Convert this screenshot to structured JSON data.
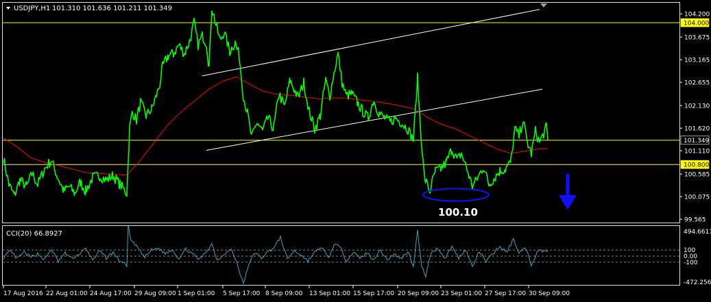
{
  "header": {
    "caret_icon": "triangle-down-icon",
    "symbol": "USDJPY,H1",
    "ohlc": "101.310 101.636 101.211 101.349"
  },
  "indicator": {
    "label": "CCI(20) 66.8927",
    "ticks": [
      "494.6611",
      "100",
      "0.00",
      "-100",
      "-472.2561"
    ]
  },
  "annotations": {
    "support_label": "100.10",
    "arrow_icon": "arrow-down-icon"
  },
  "colors": {
    "background": "#000000",
    "price": "#00ff00",
    "ma": "#ff0000",
    "channel": "#ffffff",
    "level": "#ffff00",
    "cci": "#4aa3b5",
    "ellipse": "#1010ff",
    "arrow": "#1010ff",
    "axis_text": "#ffffff",
    "label_bg": "#ffff00"
  },
  "chart_data": {
    "type": "line",
    "symbol": "USDJPY",
    "timeframe": "H1",
    "x_labels": [
      "17 Aug 2016",
      "22 Aug 01:00",
      "24 Aug 17:00",
      "29 Aug 09:00",
      "1 Sep 01:00",
      "5 Sep 17:00",
      "8 Sep 09:00",
      "13 Sep 01:00",
      "15 Sep 17:00",
      "20 Sep 09:00",
      "23 Sep 01:00",
      "27 Sep 17:00",
      "30 Sep 09:00"
    ],
    "y_ticks": [
      "104.200",
      "103.675",
      "103.165",
      "102.655",
      "102.130",
      "101.620",
      "101.110",
      "100.585",
      "100.075",
      "99.565"
    ],
    "ylim": [
      99.49,
      104.45
    ],
    "price_labels": [
      {
        "value": 104.0,
        "text": "104.000"
      },
      {
        "value": 101.349,
        "text": "101.349"
      },
      {
        "value": 100.8,
        "text": "100.800"
      }
    ],
    "horizontal_levels": [
      104.0,
      101.349,
      100.8
    ],
    "price_series": [
      [
        0,
        100.95
      ],
      [
        8,
        100.35
      ],
      [
        16,
        100.1
      ],
      [
        24,
        100.45
      ],
      [
        34,
        100.3
      ],
      [
        42,
        100.6
      ],
      [
        50,
        100.35
      ],
      [
        60,
        100.7
      ],
      [
        70,
        100.9
      ],
      [
        78,
        100.55
      ],
      [
        88,
        100.2
      ],
      [
        96,
        100.3
      ],
      [
        104,
        100.15
      ],
      [
        112,
        100.4
      ],
      [
        120,
        100.2
      ],
      [
        130,
        100.5
      ],
      [
        140,
        100.55
      ],
      [
        150,
        100.45
      ],
      [
        160,
        100.55
      ],
      [
        170,
        100.35
      ],
      [
        180,
        100.15
      ],
      [
        184,
        101.6
      ],
      [
        188,
        102.0
      ],
      [
        194,
        101.8
      ],
      [
        200,
        102.2
      ],
      [
        208,
        101.9
      ],
      [
        216,
        102.05
      ],
      [
        222,
        102.3
      ],
      [
        228,
        102.6
      ],
      [
        232,
        103.0
      ],
      [
        240,
        103.25
      ],
      [
        248,
        103.3
      ],
      [
        256,
        103.5
      ],
      [
        264,
        103.3
      ],
      [
        272,
        103.6
      ],
      [
        278,
        104.0
      ],
      [
        284,
        103.5
      ],
      [
        290,
        103.7
      ],
      [
        296,
        103.55
      ],
      [
        300,
        103.0
      ],
      [
        304,
        104.35
      ],
      [
        310,
        103.95
      ],
      [
        316,
        103.6
      ],
      [
        322,
        103.8
      ],
      [
        330,
        103.35
      ],
      [
        338,
        103.55
      ],
      [
        344,
        103.25
      ],
      [
        350,
        102.35
      ],
      [
        356,
        101.95
      ],
      [
        362,
        101.4
      ],
      [
        370,
        101.75
      ],
      [
        378,
        101.55
      ],
      [
        386,
        101.85
      ],
      [
        394,
        101.6
      ],
      [
        402,
        102.4
      ],
      [
        410,
        102.1
      ],
      [
        418,
        102.7
      ],
      [
        424,
        102.5
      ],
      [
        430,
        102.3
      ],
      [
        438,
        102.65
      ],
      [
        446,
        102.0
      ],
      [
        454,
        101.6
      ],
      [
        462,
        101.9
      ],
      [
        470,
        102.7
      ],
      [
        476,
        102.35
      ],
      [
        482,
        102.85
      ],
      [
        488,
        103.3
      ],
      [
        494,
        102.65
      ],
      [
        500,
        102.35
      ],
      [
        508,
        102.4
      ],
      [
        516,
        102.2
      ],
      [
        524,
        102.0
      ],
      [
        532,
        101.85
      ],
      [
        540,
        102.25
      ],
      [
        548,
        101.95
      ],
      [
        556,
        101.85
      ],
      [
        564,
        101.75
      ],
      [
        572,
        101.85
      ],
      [
        580,
        101.75
      ],
      [
        590,
        101.6
      ],
      [
        598,
        101.35
      ],
      [
        604,
        102.75
      ],
      [
        608,
        101.7
      ],
      [
        614,
        100.5
      ],
      [
        622,
        100.2
      ],
      [
        630,
        100.65
      ],
      [
        638,
        100.7
      ],
      [
        646,
        100.85
      ],
      [
        654,
        101.15
      ],
      [
        662,
        100.9
      ],
      [
        668,
        101.05
      ],
      [
        676,
        100.7
      ],
      [
        684,
        100.3
      ],
      [
        692,
        100.5
      ],
      [
        700,
        100.75
      ],
      [
        708,
        100.35
      ],
      [
        716,
        100.5
      ],
      [
        724,
        100.65
      ],
      [
        732,
        100.7
      ],
      [
        740,
        100.85
      ],
      [
        746,
        101.6
      ],
      [
        752,
        101.45
      ],
      [
        758,
        101.8
      ],
      [
        764,
        101.3
      ],
      [
        770,
        101.05
      ],
      [
        776,
        101.55
      ],
      [
        782,
        101.3
      ],
      [
        788,
        101.5
      ],
      [
        792,
        101.65
      ],
      [
        794,
        101.35
      ]
    ],
    "moving_average": [
      [
        0,
        101.4
      ],
      [
        20,
        101.2
      ],
      [
        40,
        100.95
      ],
      [
        60,
        100.85
      ],
      [
        80,
        100.78
      ],
      [
        100,
        100.7
      ],
      [
        120,
        100.62
      ],
      [
        140,
        100.6
      ],
      [
        160,
        100.58
      ],
      [
        180,
        100.56
      ],
      [
        200,
        100.9
      ],
      [
        220,
        101.3
      ],
      [
        240,
        101.7
      ],
      [
        260,
        102.0
      ],
      [
        280,
        102.25
      ],
      [
        300,
        102.5
      ],
      [
        320,
        102.68
      ],
      [
        340,
        102.78
      ],
      [
        360,
        102.6
      ],
      [
        380,
        102.45
      ],
      [
        400,
        102.38
      ],
      [
        420,
        102.36
      ],
      [
        440,
        102.32
      ],
      [
        460,
        102.28
      ],
      [
        480,
        102.3
      ],
      [
        500,
        102.3
      ],
      [
        520,
        102.26
      ],
      [
        540,
        102.22
      ],
      [
        560,
        102.18
      ],
      [
        580,
        102.12
      ],
      [
        600,
        102.05
      ],
      [
        620,
        101.85
      ],
      [
        640,
        101.7
      ],
      [
        660,
        101.6
      ],
      [
        680,
        101.45
      ],
      [
        700,
        101.3
      ],
      [
        720,
        101.15
      ],
      [
        740,
        101.05
      ],
      [
        760,
        101.1
      ],
      [
        780,
        101.15
      ],
      [
        794,
        101.16
      ]
    ],
    "channel_lines": [
      {
        "points": [
          [
            290,
            102.8
          ],
          [
            782,
            104.3
          ]
        ]
      },
      {
        "points": [
          [
            296,
            101.12
          ],
          [
            786,
            102.5
          ]
        ]
      }
    ],
    "support_zone": {
      "x_center": 660,
      "value": 100.1,
      "label": "100.10"
    },
    "cci": {
      "name": "CCI(20)",
      "last": 66.8927,
      "ylim": [
        -472.2561,
        494.6611
      ],
      "levels": [
        100,
        0,
        -100
      ],
      "series": [
        [
          0,
          -30
        ],
        [
          10,
          80
        ],
        [
          20,
          -40
        ],
        [
          30,
          60
        ],
        [
          40,
          -20
        ],
        [
          50,
          40
        ],
        [
          60,
          -60
        ],
        [
          70,
          110
        ],
        [
          80,
          -90
        ],
        [
          90,
          50
        ],
        [
          100,
          -40
        ],
        [
          110,
          30
        ],
        [
          120,
          120
        ],
        [
          130,
          -60
        ],
        [
          140,
          80
        ],
        [
          150,
          -30
        ],
        [
          160,
          60
        ],
        [
          170,
          -80
        ],
        [
          180,
          -150
        ],
        [
          182,
          494
        ],
        [
          186,
          250
        ],
        [
          196,
          140
        ],
        [
          206,
          -20
        ],
        [
          216,
          100
        ],
        [
          226,
          130
        ],
        [
          236,
          40
        ],
        [
          246,
          110
        ],
        [
          256,
          -40
        ],
        [
          266,
          120
        ],
        [
          276,
          30
        ],
        [
          286,
          -60
        ],
        [
          296,
          80
        ],
        [
          304,
          200
        ],
        [
          312,
          -70
        ],
        [
          322,
          40
        ],
        [
          332,
          110
        ],
        [
          340,
          -90
        ],
        [
          350,
          -460
        ],
        [
          356,
          -200
        ],
        [
          366,
          60
        ],
        [
          376,
          -30
        ],
        [
          386,
          70
        ],
        [
          396,
          160
        ],
        [
          404,
          310
        ],
        [
          414,
          -50
        ],
        [
          424,
          90
        ],
        [
          434,
          20
        ],
        [
          444,
          -80
        ],
        [
          454,
          60
        ],
        [
          464,
          150
        ],
        [
          474,
          -40
        ],
        [
          484,
          220
        ],
        [
          492,
          120
        ],
        [
          500,
          -70
        ],
        [
          510,
          60
        ],
        [
          520,
          -30
        ],
        [
          530,
          50
        ],
        [
          540,
          -50
        ],
        [
          550,
          90
        ],
        [
          560,
          -60
        ],
        [
          570,
          30
        ],
        [
          580,
          -40
        ],
        [
          590,
          80
        ],
        [
          598,
          -160
        ],
        [
          604,
          420
        ],
        [
          610,
          -180
        ],
        [
          616,
          -320
        ],
        [
          624,
          60
        ],
        [
          634,
          130
        ],
        [
          644,
          -40
        ],
        [
          654,
          160
        ],
        [
          664,
          -30
        ],
        [
          674,
          110
        ],
        [
          684,
          -180
        ],
        [
          694,
          80
        ],
        [
          704,
          -90
        ],
        [
          714,
          40
        ],
        [
          724,
          160
        ],
        [
          734,
          60
        ],
        [
          744,
          280
        ],
        [
          752,
          60
        ],
        [
          762,
          130
        ],
        [
          770,
          -140
        ],
        [
          780,
          100
        ],
        [
          788,
          80
        ],
        [
          794,
          66.9
        ]
      ]
    }
  }
}
